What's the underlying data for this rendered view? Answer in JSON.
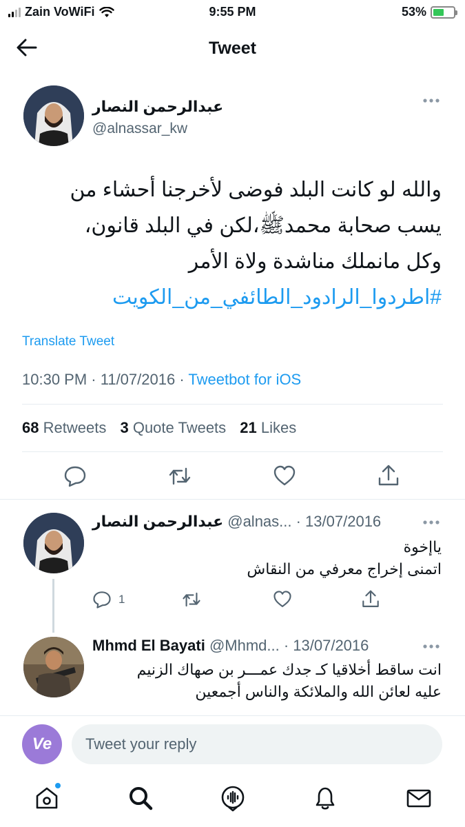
{
  "status_bar": {
    "carrier": "Zain VoWiFi",
    "time": "9:55 PM",
    "battery_percent": "53%",
    "battery_level": 0.53
  },
  "nav": {
    "title": "Tweet"
  },
  "tweet": {
    "author_name": "عبدالرحمن النصار",
    "author_handle": "@alnassar_kw",
    "body_lines": [
      "والله لو كانت البلد فوضى لأخرجنا أحشاء من",
      "يسب صحابة محمدﷺ،لكن في البلد قانون،",
      "وكل مانملك مناشدة ولاة الأمر"
    ],
    "hashtag": "#اطردوا_الرادود_الطائفي_من_الكويت",
    "translate_label": "Translate Tweet",
    "time": "10:30 PM",
    "separator1": " · ",
    "date": "11/07/2016",
    "separator2": " · ",
    "source": "Tweetbot for iOS",
    "stats": {
      "retweets_count": "68",
      "retweets_label": "Retweets",
      "quotes_count": "3",
      "quotes_label": "Quote Tweets",
      "likes_count": "21",
      "likes_label": "Likes"
    }
  },
  "replies": [
    {
      "name": "عبدالرحمن النصار",
      "handle": "@alnas...",
      "date": " · 13/07/2016",
      "lines": [
        "ياإخوة",
        "اتمنى إخراج معرفي من النقاش"
      ],
      "reply_count": "1"
    },
    {
      "name": "Mhmd El Bayati",
      "handle": "@Mhmd...",
      "date": " · 13/07/2016",
      "lines": [
        "انت ساقط أخلاقيا كـ جدك عمـــر بن صهاك الزنيم",
        "عليه لعائن الله والملائكة والناس أجمعين"
      ]
    }
  ],
  "compose": {
    "avatar_text": "Ve",
    "placeholder": "Tweet your reply"
  },
  "colors": {
    "accent": "#1d9bf0",
    "secondary_text": "#536471",
    "divider": "#e6ecf0"
  },
  "icons": {
    "back": "arrow-left-icon",
    "more": "ellipsis-icon",
    "reply": "speech-bubble-icon",
    "retweet": "retweet-icon",
    "like": "heart-icon",
    "share": "share-icon",
    "home": "home-icon",
    "search": "search-icon",
    "spaces": "microphone-icon",
    "notifications": "bell-icon",
    "messages": "envelope-icon"
  }
}
